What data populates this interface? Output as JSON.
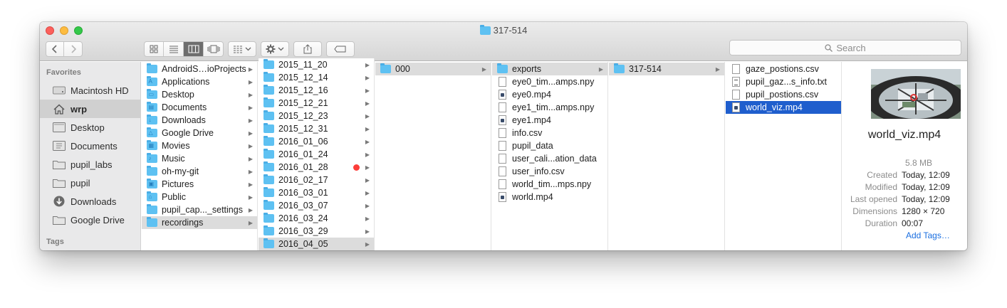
{
  "window": {
    "title": "317-514"
  },
  "toolbar": {
    "search_placeholder": "Search"
  },
  "sidebar": {
    "favorites_heading": "Favorites",
    "tags_heading": "Tags",
    "items": [
      {
        "label": "Macintosh HD",
        "icon": "hard-drive-icon"
      },
      {
        "label": "wrp",
        "icon": "home-icon"
      },
      {
        "label": "Desktop",
        "icon": "desktop-icon"
      },
      {
        "label": "Documents",
        "icon": "documents-icon"
      },
      {
        "label": "pupil_labs",
        "icon": "folder-icon"
      },
      {
        "label": "pupil",
        "icon": "folder-icon"
      },
      {
        "label": "Downloads",
        "icon": "downloads-icon"
      },
      {
        "label": "Google Drive",
        "icon": "folder-icon"
      }
    ]
  },
  "columns": {
    "home": [
      {
        "label": "AndroidS…ioProjects",
        "glyph": ""
      },
      {
        "label": "Applications",
        "glyph": "A"
      },
      {
        "label": "Desktop",
        "glyph": "▭"
      },
      {
        "label": "Documents",
        "glyph": "▤"
      },
      {
        "label": "Downloads",
        "glyph": "↓"
      },
      {
        "label": "Google Drive",
        "glyph": "△"
      },
      {
        "label": "Movies",
        "glyph": "▦"
      },
      {
        "label": "Music",
        "glyph": "♪"
      },
      {
        "label": "oh-my-git",
        "glyph": ""
      },
      {
        "label": "Pictures",
        "glyph": "▣"
      },
      {
        "label": "Public",
        "glyph": "⌂"
      },
      {
        "label": "pupil_cap..._settings",
        "glyph": ""
      },
      {
        "label": "recordings",
        "glyph": ""
      }
    ],
    "recordings": [
      "2015_11_20",
      "2015_12_14",
      "2015_12_16",
      "2015_12_21",
      "2015_12_23",
      "2015_12_31",
      "2016_01_06",
      "2016_01_24",
      "2016_01_28",
      "2016_02_17",
      "2016_03_01",
      "2016_03_07",
      "2016_03_24",
      "2016_03_29",
      "2016_04_05"
    ],
    "recording": [
      "000"
    ],
    "session": [
      {
        "label": "exports",
        "type": "folder"
      },
      {
        "label": "eye0_tim...amps.npy",
        "type": "doc"
      },
      {
        "label": "eye0.mp4",
        "type": "video"
      },
      {
        "label": "eye1_tim...amps.npy",
        "type": "doc"
      },
      {
        "label": "eye1.mp4",
        "type": "video"
      },
      {
        "label": "info.csv",
        "type": "doc"
      },
      {
        "label": "pupil_data",
        "type": "doc"
      },
      {
        "label": "user_cali...ation_data",
        "type": "doc"
      },
      {
        "label": "user_info.csv",
        "type": "doc"
      },
      {
        "label": "world_tim...mps.npy",
        "type": "doc"
      },
      {
        "label": "world.mp4",
        "type": "video"
      }
    ],
    "exports": [
      "317-514"
    ],
    "export_files": [
      {
        "label": "gaze_postions.csv",
        "type": "doc"
      },
      {
        "label": "pupil_gaz...s_info.txt",
        "type": "txt"
      },
      {
        "label": "pupil_postions.csv",
        "type": "doc"
      },
      {
        "label": "world_viz.mp4",
        "type": "video"
      }
    ]
  },
  "preview": {
    "name": "world_viz.mp4",
    "size": "5.8 MB",
    "meta": [
      {
        "key": "Created",
        "value": "Today, 12:09"
      },
      {
        "key": "Modified",
        "value": "Today, 12:09"
      },
      {
        "key": "Last opened",
        "value": "Today, 12:09"
      },
      {
        "key": "Dimensions",
        "value": "1280 × 720"
      },
      {
        "key": "Duration",
        "value": "00:07"
      }
    ],
    "add_tags": "Add Tags…"
  },
  "colors": {
    "selection_blue": "#1f5ecd",
    "folder_blue": "#5ec1f2",
    "tag_red": "#fc3d39",
    "link_blue": "#1b6fe0"
  }
}
